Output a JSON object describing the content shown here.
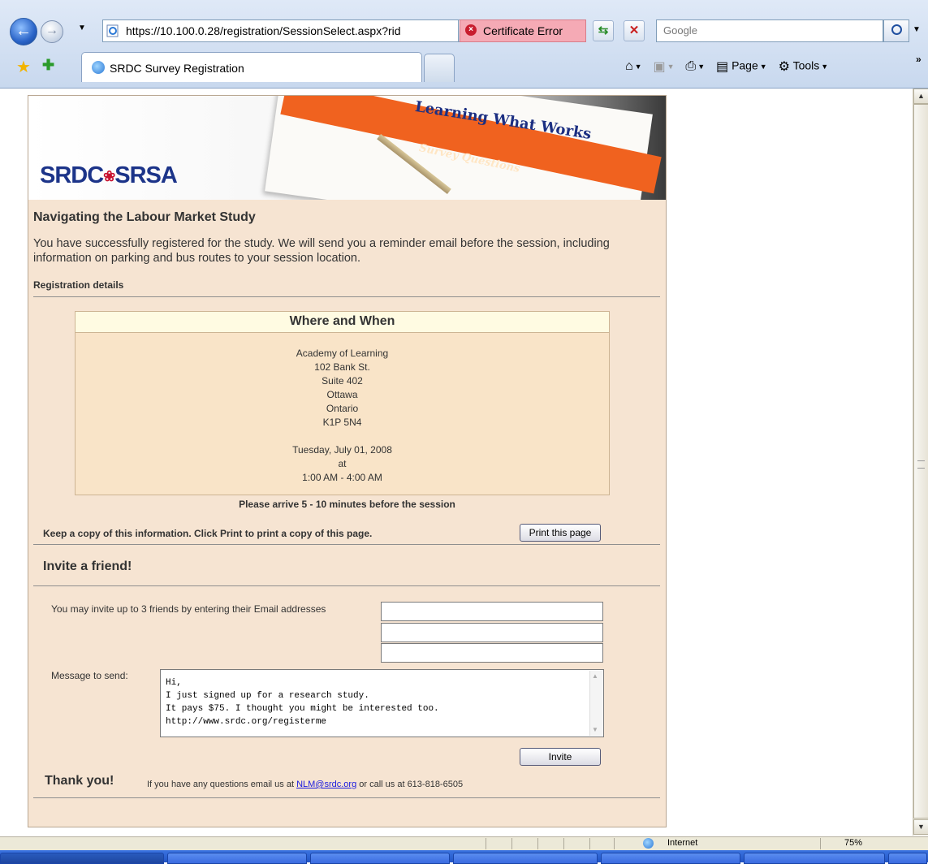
{
  "browser": {
    "address": "https://10.100.0.28/registration/SessionSelect.aspx?rid",
    "certificate_error": "Certificate Error",
    "search_placeholder": "Google",
    "tab_title": "SRDC Survey Registration",
    "commands": {
      "page": "Page",
      "tools": "Tools"
    },
    "status_zone": "Internet",
    "zoom": "75%"
  },
  "banner": {
    "logo": "SRDC SRSA",
    "tagline": "Learning What Works",
    "band_text": "Survey Questions"
  },
  "page": {
    "study_title": "Navigating the Labour Market Study",
    "success_message": "You have successfully registered for the study.  We will send you a reminder email before the session, including information on parking and bus routes to your session location.",
    "registration_details_label": "Registration details",
    "where_when": {
      "title": "Where and When",
      "address_lines": [
        "Academy of Learning",
        "102 Bank St.",
        "Suite 402",
        "Ottawa",
        "Ontario",
        "K1P 5N4"
      ],
      "date": "Tuesday, July 01, 2008",
      "at": "at",
      "time": "1:00 AM - 4:00 AM"
    },
    "arrive_note": "Please arrive 5 - 10 minutes before the session",
    "keep_copy": "Keep a copy of this information.  Click Print to print a copy of this page.",
    "print_button": "Print this page",
    "invite": {
      "title": "Invite a friend!",
      "emails_label": "You may invite up to 3 friends by entering their Email addresses",
      "emails": [
        "",
        "",
        ""
      ],
      "message_label": "Message to send:",
      "message": "Hi,\nI just signed up for a research study.\nIt pays $75. I thought you might be interested too.\nhttp://www.srdc.org/registerme",
      "button": "Invite"
    },
    "thank_you": "Thank you!",
    "contact_prefix": "If you have any questions email us at",
    "contact_email": "NLM@srdc.org",
    "contact_suffix": "or call us at 613-818-6505"
  }
}
